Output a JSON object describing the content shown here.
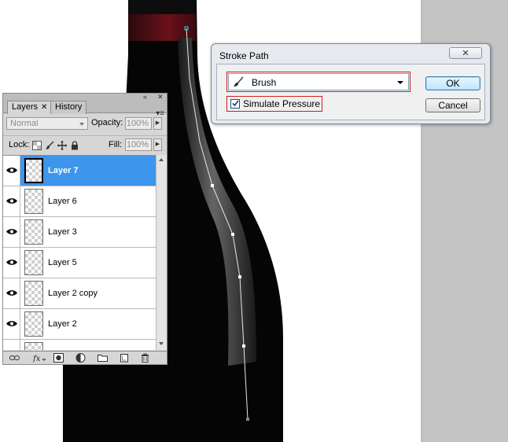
{
  "dialog": {
    "title": "Stroke Path",
    "close_icon": "close-icon",
    "tool_select": {
      "value": "Brush",
      "icon": "brush-icon"
    },
    "simulate_pressure": {
      "label": "Simulate Pressure",
      "checked": true
    },
    "ok_label": "OK",
    "cancel_label": "Cancel"
  },
  "layers_panel": {
    "tabs": [
      {
        "label": "Layers",
        "active": true
      },
      {
        "label": "History",
        "active": false
      }
    ],
    "blend_mode": "Normal",
    "opacity_label": "Opacity:",
    "opacity_value": "100%",
    "lock_label": "Lock:",
    "fill_label": "Fill:",
    "fill_value": "100%",
    "layers": [
      {
        "name": "Layer 7",
        "selected": true
      },
      {
        "name": "Layer 6",
        "selected": false
      },
      {
        "name": "Layer 3",
        "selected": false
      },
      {
        "name": "Layer 5",
        "selected": false
      },
      {
        "name": "Layer 2 copy",
        "selected": false
      },
      {
        "name": "Layer 2",
        "selected": false
      }
    ],
    "bottom_icons": [
      "link-icon",
      "fx-icon",
      "mask-icon",
      "adjustment-icon",
      "group-folder-icon",
      "new-layer-icon",
      "trash-icon"
    ]
  },
  "colors": {
    "selection": "#3d95ec",
    "highlight_outline": "#cc1f1f",
    "bottle": "#050505",
    "gray_margin": "#c4c4c4"
  }
}
